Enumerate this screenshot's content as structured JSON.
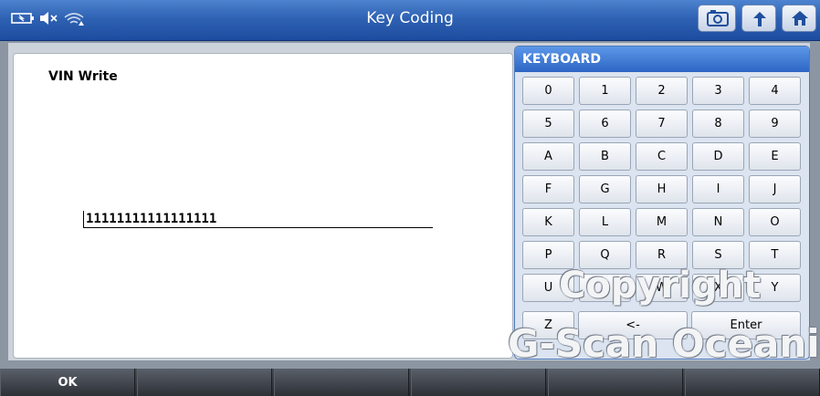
{
  "window": {
    "title": "Key Coding"
  },
  "status_icons": [
    "battery-icon",
    "speaker-muted-icon",
    "wifi-icon"
  ],
  "toolbar_icons": [
    "camera-icon",
    "back-arrow-icon",
    "home-icon"
  ],
  "content": {
    "section_label": "VIN Write",
    "vin_value": "11111111111111111"
  },
  "keyboard": {
    "title": "KEYBOARD",
    "rows": [
      [
        "0",
        "1",
        "2",
        "3",
        "4"
      ],
      [
        "5",
        "6",
        "7",
        "8",
        "9"
      ],
      [
        "A",
        "B",
        "C",
        "D",
        "E"
      ],
      [
        "F",
        "G",
        "H",
        "I",
        "J"
      ],
      [
        "K",
        "L",
        "M",
        "N",
        "O"
      ],
      [
        "P",
        "Q",
        "R",
        "S",
        "T"
      ],
      [
        "U",
        "V",
        "W",
        "X",
        "Y"
      ]
    ],
    "last_row": {
      "z": "Z",
      "backspace": "<-",
      "enter": "Enter"
    }
  },
  "bottom_bar": {
    "buttons": [
      "OK",
      "",
      "",
      "",
      "",
      ""
    ]
  },
  "watermark": {
    "line1": "Copyright",
    "line2": "G-Scan Oceania"
  },
  "colors": {
    "title_bar": "#2f62b3",
    "keyboard_header": "#2d66c4",
    "bottom_bar": "#2d3036"
  }
}
